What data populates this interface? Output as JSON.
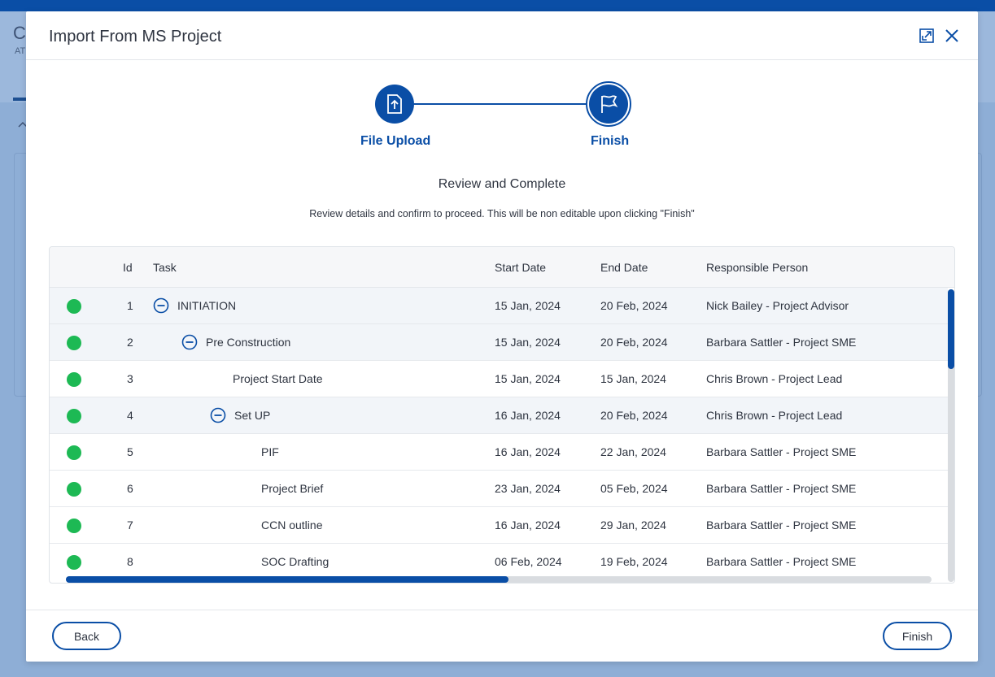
{
  "background": {
    "title_fragment": "C",
    "subtitle_fragment": "AT"
  },
  "modal": {
    "title": "Import From MS Project",
    "expand_icon": "expand-icon",
    "close_icon": "close-icon"
  },
  "stepper": {
    "steps": [
      {
        "label": "File Upload",
        "icon": "file-upload-icon",
        "state": "completed"
      },
      {
        "label": "Finish",
        "icon": "flag-icon",
        "state": "active"
      }
    ]
  },
  "review": {
    "title": "Review and Complete",
    "subtitle": "Review details and confirm to proceed. This will be non editable upon clicking \"Finish\""
  },
  "table": {
    "columns": [
      "Id",
      "Task",
      "Start Date",
      "End Date",
      "Responsible Person"
    ],
    "rows": [
      {
        "id": "1",
        "task": "INITIATION",
        "start": "15 Jan, 2024",
        "end": "20 Feb, 2024",
        "person": "Nick Bailey - Project Advisor",
        "status_color": "#1db954"
      },
      {
        "id": "2",
        "task": "Pre Construction",
        "start": "15 Jan, 2024",
        "end": "20 Feb, 2024",
        "person": "Barbara Sattler - Project SME",
        "status_color": "#1db954"
      },
      {
        "id": "3",
        "task": "Project Start Date",
        "start": "15 Jan, 2024",
        "end": "15 Jan, 2024",
        "person": "Chris Brown - Project Lead",
        "status_color": "#1db954"
      },
      {
        "id": "4",
        "task": "Set UP",
        "start": "16 Jan, 2024",
        "end": "20 Feb, 2024",
        "person": "Chris Brown - Project Lead",
        "status_color": "#1db954"
      },
      {
        "id": "5",
        "task": "PIF",
        "start": "16 Jan, 2024",
        "end": "22 Jan, 2024",
        "person": "Barbara Sattler - Project SME",
        "status_color": "#1db954"
      },
      {
        "id": "6",
        "task": "Project Brief",
        "start": "23 Jan, 2024",
        "end": "05 Feb, 2024",
        "person": "Barbara Sattler - Project SME",
        "status_color": "#1db954"
      },
      {
        "id": "7",
        "task": "CCN outline",
        "start": "16 Jan, 2024",
        "end": "29 Jan, 2024",
        "person": "Barbara Sattler - Project SME",
        "status_color": "#1db954"
      },
      {
        "id": "8",
        "task": "SOC Drafting",
        "start": "06 Feb, 2024",
        "end": "19 Feb, 2024",
        "person": "Barbara Sattler - Project SME",
        "status_color": "#1db954"
      }
    ]
  },
  "footer": {
    "back_label": "Back",
    "finish_label": "Finish"
  },
  "colors": {
    "accent": "#0a4ea6",
    "status_green": "#1db954"
  }
}
